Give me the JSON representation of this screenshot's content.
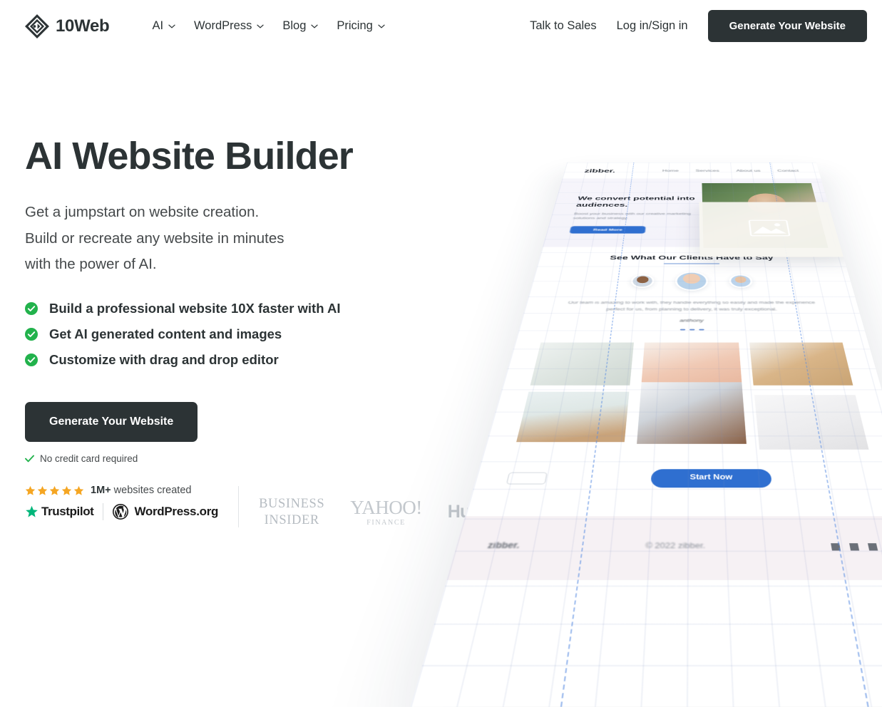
{
  "header": {
    "brand": {
      "name": "10Web",
      "icon": "10web-diamond-logo"
    },
    "nav": [
      {
        "label": "AI",
        "icon": "chevron-down-icon"
      },
      {
        "label": "WordPress",
        "icon": "chevron-down-icon"
      },
      {
        "label": "Blog",
        "icon": "chevron-down-icon"
      },
      {
        "label": "Pricing",
        "icon": "chevron-down-icon"
      }
    ],
    "talk_to_sales": "Talk to Sales",
    "login_signin": "Log in/Sign in",
    "cta": "Generate Your Website"
  },
  "hero": {
    "title": "AI Website Builder",
    "subtitle_lines": [
      "Get a jumpstart on website creation.",
      "Build or recreate any website in minutes",
      "with the power of AI."
    ],
    "features": [
      "Build a professional website 10X faster with AI",
      "Get AI generated content and images",
      "Customize with drag and drop editor"
    ],
    "cta": "Generate Your Website",
    "no_credit_card": "No credit card required"
  },
  "social_proof": {
    "stars": 5,
    "count_label": "1M+",
    "count_suffix": "websites created",
    "trustpilot": "Trustpilot",
    "wordpress": "WordPress.org",
    "press": {
      "business_insider_line1": "BUSINESS",
      "business_insider_line2": "INSIDER",
      "yahoo_main": "YAHOO!",
      "yahoo_sub": "FINANCE",
      "hubspot": "HubSpot"
    }
  },
  "mockup": {
    "brand": "zibber.",
    "nav": [
      "Home",
      "Services",
      "About us",
      "Contact"
    ],
    "headline": "We convert potential into audiences.",
    "paragraph": "Boost your business with our creative marketing solutions and strategy.",
    "hero_button": "Read More",
    "section_title": "See What Our Clients Have to Say",
    "quote": "Our team is amazing to work with, they handle everything so easily and made the experience perfect for us, from planning to delivery, it was truly exceptional.",
    "quote_author": "anthony",
    "start_button": "Start Now",
    "footer_brand": "zibber.",
    "footer_copy": "© 2022 zibber."
  },
  "colors": {
    "dark": "#2c3335",
    "green": "#22b24c",
    "star": "#f5a623",
    "trustpilot_green": "#00b67a",
    "mockup_blue": "#2f6fd0"
  }
}
